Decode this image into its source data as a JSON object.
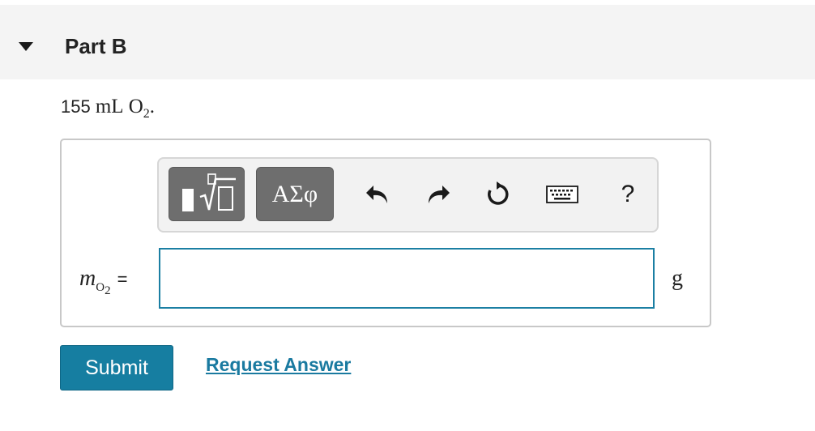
{
  "part": {
    "title": "Part B"
  },
  "problem": {
    "quantity": "155",
    "unit": "mL",
    "species": "O",
    "species_sub": "2",
    "period": "."
  },
  "toolbar": {
    "symbols_label": "ΑΣφ",
    "help_label": "?"
  },
  "answer": {
    "variable": "m",
    "var_sub_base": "O",
    "var_sub_sub": "2",
    "equals": "=",
    "value": "",
    "unit": "g"
  },
  "actions": {
    "submit_label": "Submit",
    "request_label": "Request Answer"
  },
  "colors": {
    "accent": "#167ea1",
    "link": "#1a7aa0",
    "toolbar_button": "#6e6e6e"
  }
}
